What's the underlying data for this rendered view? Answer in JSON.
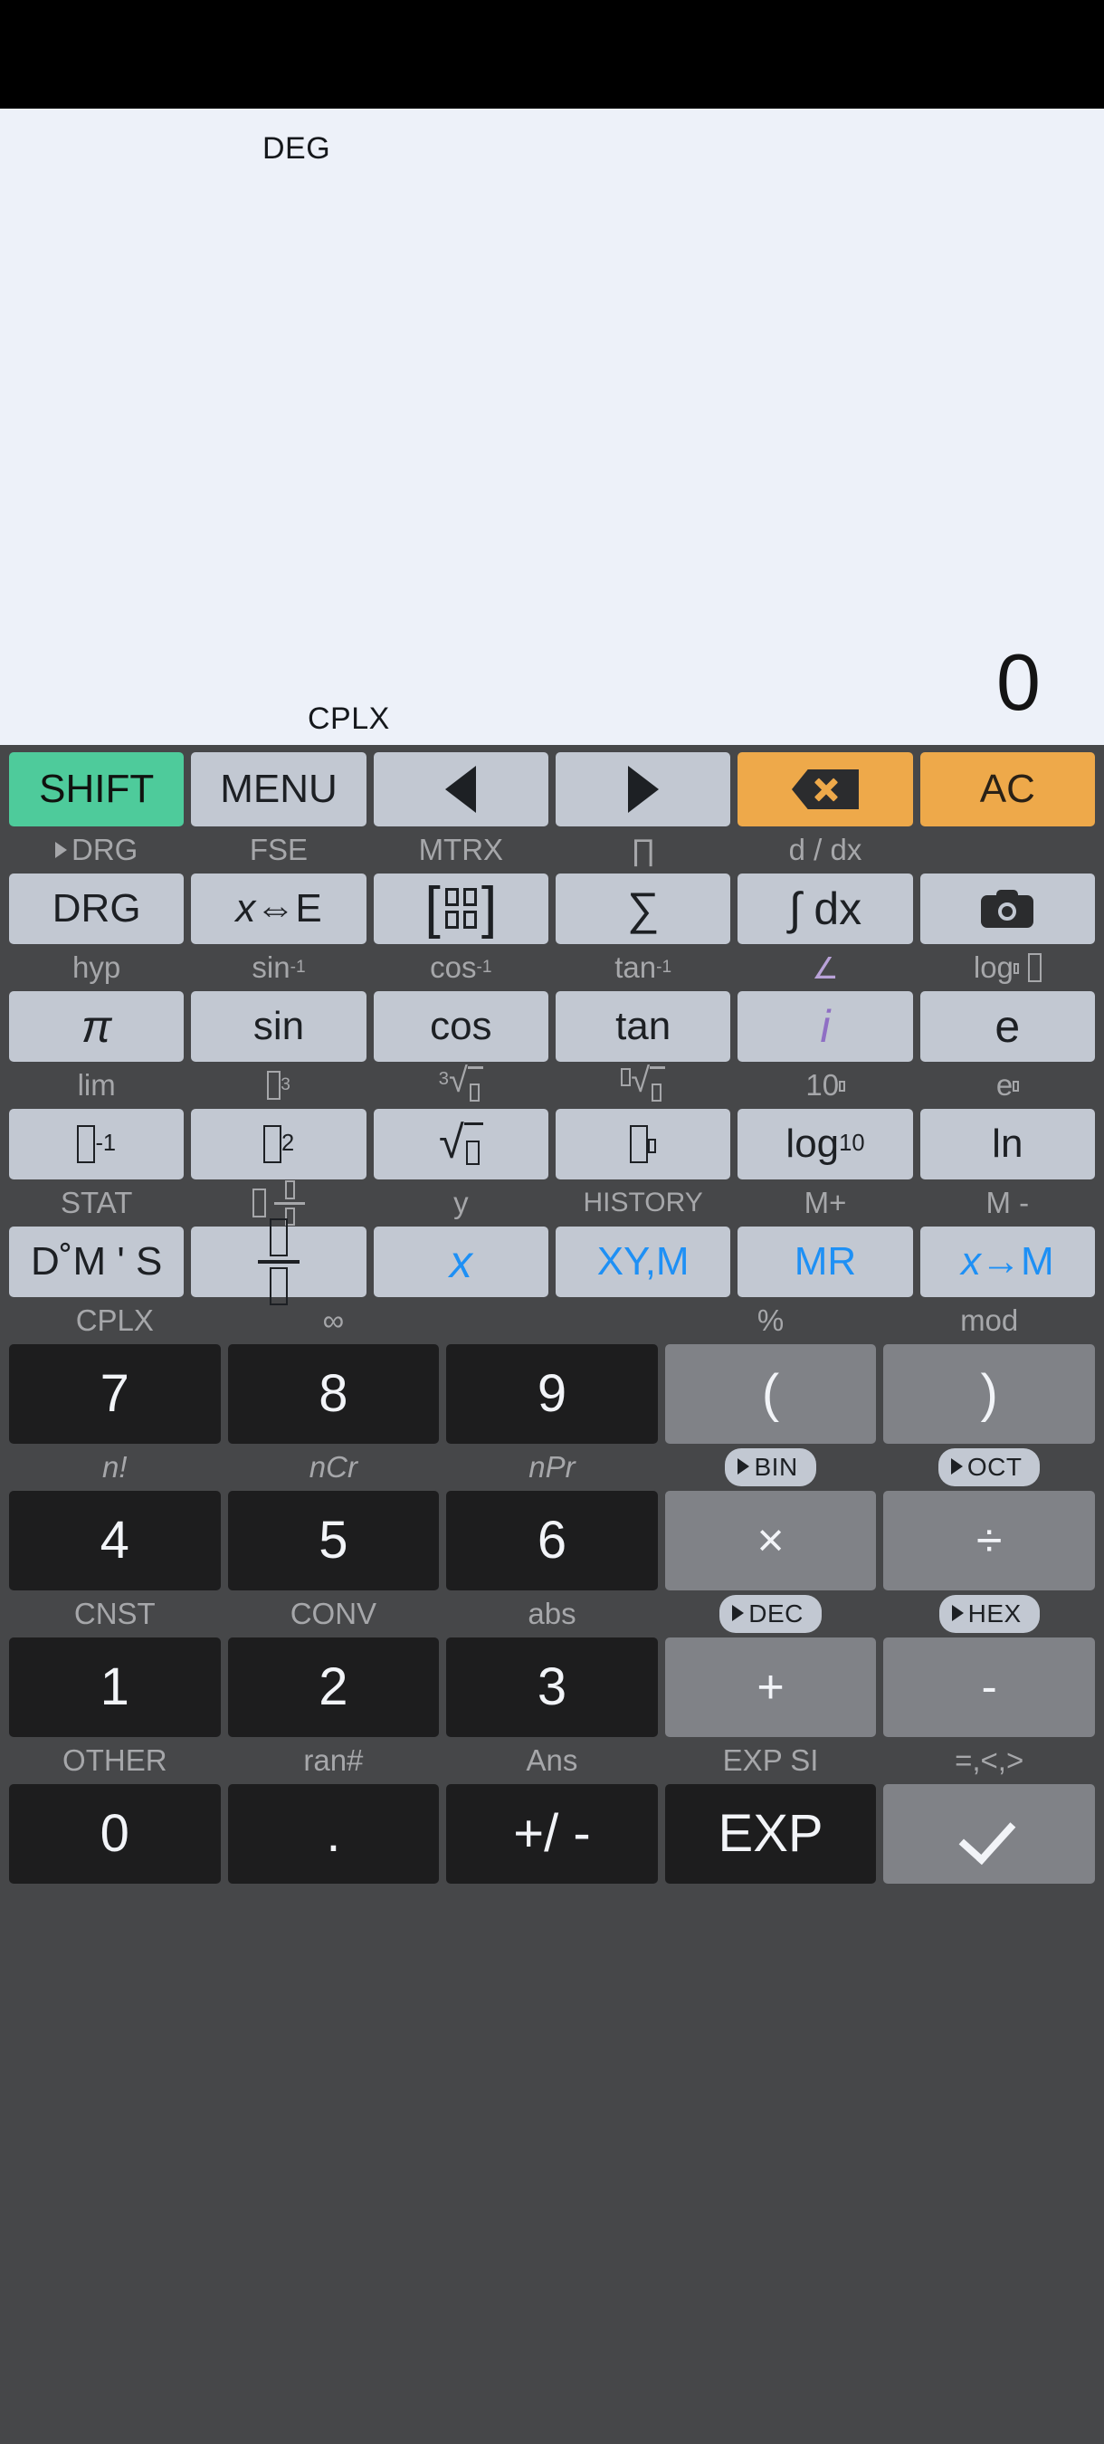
{
  "display": {
    "mode_top": "DEG",
    "value": "0",
    "mode_bottom": "CPLX"
  },
  "colors": {
    "shift": "#4ecb9b",
    "action": "#eea94a",
    "function_key": "#c2c8d2",
    "number_key": "#1d1d1e",
    "operator_key": "#808287",
    "keypad_bg": "#464749",
    "display_bg": "#edf1f9",
    "memory_text": "#1e90f5",
    "complex_text": "#8f6fc4"
  },
  "rows": [
    {
      "name": "top-control-row",
      "labels": [],
      "keys": [
        {
          "name": "shift-button",
          "label": "SHIFT",
          "style": "green"
        },
        {
          "name": "menu-button",
          "label": "MENU",
          "style": "grey"
        },
        {
          "name": "cursor-left-button",
          "label": "",
          "style": "grey",
          "icon": "triangle-left-icon"
        },
        {
          "name": "cursor-right-button",
          "label": "",
          "style": "grey",
          "icon": "triangle-right-icon"
        },
        {
          "name": "backspace-button",
          "label": "",
          "style": "orange",
          "icon": "backspace-icon"
        },
        {
          "name": "all-clear-button",
          "label": "AC",
          "style": "orange"
        }
      ]
    },
    {
      "name": "drg-row",
      "labels": [
        {
          "name": "shift-label-drg-convert",
          "text": "►DRG"
        },
        {
          "name": "shift-label-fse",
          "text": "FSE"
        },
        {
          "name": "shift-label-mtrx",
          "text": "MTRX"
        },
        {
          "name": "shift-label-product",
          "text": "∏"
        },
        {
          "name": "shift-label-derivative",
          "text": "d / dx"
        },
        {
          "name": "shift-label-blank-camera",
          "text": ""
        }
      ],
      "keys": [
        {
          "name": "drg-button",
          "label": "DRG",
          "style": "grey"
        },
        {
          "name": "x-to-e-button",
          "label": "x⇔E",
          "style": "grey"
        },
        {
          "name": "matrix-button",
          "label": "",
          "style": "grey",
          "icon": "matrix-icon"
        },
        {
          "name": "summation-button",
          "label": "∑",
          "style": "grey"
        },
        {
          "name": "integral-dx-button",
          "label": "∫ dx",
          "style": "grey"
        },
        {
          "name": "screenshot-button",
          "label": "",
          "style": "grey",
          "icon": "camera-icon"
        }
      ]
    },
    {
      "name": "trig-row",
      "labels": [
        {
          "name": "shift-label-hyp",
          "text": "hyp"
        },
        {
          "name": "shift-label-asin",
          "text": "sin⁻¹"
        },
        {
          "name": "shift-label-acos",
          "text": "cos⁻¹"
        },
        {
          "name": "shift-label-atan",
          "text": "tan⁻¹"
        },
        {
          "name": "shift-label-angle",
          "text": "∠",
          "color": "purple"
        },
        {
          "name": "shift-label-log-base",
          "text": "log"
        }
      ],
      "keys": [
        {
          "name": "pi-button",
          "label": "π",
          "style": "grey"
        },
        {
          "name": "sin-button",
          "label": "sin",
          "style": "grey"
        },
        {
          "name": "cos-button",
          "label": "cos",
          "style": "grey"
        },
        {
          "name": "tan-button",
          "label": "tan",
          "style": "grey"
        },
        {
          "name": "imaginary-unit-button",
          "label": "i",
          "style": "grey",
          "text_color": "purple"
        },
        {
          "name": "euler-e-button",
          "label": "e",
          "style": "grey"
        }
      ]
    },
    {
      "name": "power-row",
      "labels": [
        {
          "name": "shift-label-lim",
          "text": "lim"
        },
        {
          "name": "shift-label-cube",
          "text": "cube"
        },
        {
          "name": "shift-label-cube-root",
          "text": "cube-root"
        },
        {
          "name": "shift-label-nth-root",
          "text": "nth-root"
        },
        {
          "name": "shift-label-ten-power",
          "text": "10"
        },
        {
          "name": "shift-label-e-power",
          "text": "e"
        }
      ],
      "keys": [
        {
          "name": "reciprocal-button",
          "label": "inverse",
          "style": "grey"
        },
        {
          "name": "square-button",
          "label": "square",
          "style": "grey"
        },
        {
          "name": "square-root-button",
          "label": "sqrt",
          "style": "grey"
        },
        {
          "name": "power-button",
          "label": "power",
          "style": "grey"
        },
        {
          "name": "log10-button",
          "label": "log",
          "style": "grey"
        },
        {
          "name": "ln-button",
          "label": "ln",
          "style": "grey"
        }
      ]
    },
    {
      "name": "memory-row",
      "labels": [
        {
          "name": "shift-label-stat",
          "text": "STAT"
        },
        {
          "name": "shift-label-mixed-fraction",
          "text": "mixed-fraction"
        },
        {
          "name": "shift-label-y",
          "text": "y"
        },
        {
          "name": "shift-label-history",
          "text": "HISTORY"
        },
        {
          "name": "shift-label-m-plus",
          "text": "M+"
        },
        {
          "name": "shift-label-m-minus",
          "text": "M -"
        }
      ],
      "keys": [
        {
          "name": "dms-button",
          "label": "D˚M ' S",
          "style": "grey"
        },
        {
          "name": "fraction-button",
          "label": "fraction",
          "style": "grey"
        },
        {
          "name": "var-x-button",
          "label": "x",
          "style": "grey",
          "text_color": "blue"
        },
        {
          "name": "xy-memory-button",
          "label": "XY,M",
          "style": "grey",
          "text_color": "blue"
        },
        {
          "name": "memory-recall-button",
          "label": "MR",
          "style": "grey",
          "text_color": "blue"
        },
        {
          "name": "store-to-memory-button",
          "label": "x→M",
          "style": "grey",
          "text_color": "blue"
        }
      ]
    },
    {
      "name": "789-row",
      "labels": [
        {
          "name": "shift-label-cplx",
          "text": "CPLX"
        },
        {
          "name": "shift-label-infinity",
          "text": "∞"
        },
        {
          "name": "shift-label-blank-9",
          "text": ""
        },
        {
          "name": "shift-label-percent",
          "text": "%"
        },
        {
          "name": "shift-label-mod",
          "text": "mod"
        }
      ],
      "keys": [
        {
          "name": "digit-7-button",
          "label": "7",
          "style": "dark"
        },
        {
          "name": "digit-8-button",
          "label": "8",
          "style": "dark"
        },
        {
          "name": "digit-9-button",
          "label": "9",
          "style": "dark"
        },
        {
          "name": "open-paren-button",
          "label": "(",
          "style": "mid"
        },
        {
          "name": "close-paren-button",
          "label": ")",
          "style": "mid"
        }
      ]
    },
    {
      "name": "456-row",
      "labels": [
        {
          "name": "shift-label-factorial",
          "text": "n!"
        },
        {
          "name": "shift-label-ncr",
          "text": "nCr"
        },
        {
          "name": "shift-label-npr",
          "text": "nPr"
        },
        {
          "name": "shift-label-to-bin",
          "text": "►BIN",
          "pill": true
        },
        {
          "name": "shift-label-to-oct",
          "text": "►OCT",
          "pill": true
        }
      ],
      "keys": [
        {
          "name": "digit-4-button",
          "label": "4",
          "style": "dark"
        },
        {
          "name": "digit-5-button",
          "label": "5",
          "style": "dark"
        },
        {
          "name": "digit-6-button",
          "label": "6",
          "style": "dark"
        },
        {
          "name": "multiply-button",
          "label": "×",
          "style": "mid"
        },
        {
          "name": "divide-button",
          "label": "÷",
          "style": "mid"
        }
      ]
    },
    {
      "name": "123-row",
      "labels": [
        {
          "name": "shift-label-cnst",
          "text": "CNST"
        },
        {
          "name": "shift-label-conv",
          "text": "CONV"
        },
        {
          "name": "shift-label-abs",
          "text": "abs"
        },
        {
          "name": "shift-label-to-dec",
          "text": "►DEC",
          "pill": true
        },
        {
          "name": "shift-label-to-hex",
          "text": "►HEX",
          "pill": true
        }
      ],
      "keys": [
        {
          "name": "digit-1-button",
          "label": "1",
          "style": "dark"
        },
        {
          "name": "digit-2-button",
          "label": "2",
          "style": "dark"
        },
        {
          "name": "digit-3-button",
          "label": "3",
          "style": "dark"
        },
        {
          "name": "plus-button",
          "label": "+",
          "style": "mid"
        },
        {
          "name": "minus-button",
          "label": "-",
          "style": "mid"
        }
      ]
    },
    {
      "name": "0-row",
      "labels": [
        {
          "name": "shift-label-other",
          "text": "OTHER"
        },
        {
          "name": "shift-label-random",
          "text": "ran#"
        },
        {
          "name": "shift-label-ans",
          "text": "Ans"
        },
        {
          "name": "shift-label-exp-si",
          "text": "EXP SI"
        },
        {
          "name": "shift-label-relations",
          "text": "=,<,>"
        }
      ],
      "keys": [
        {
          "name": "digit-0-button",
          "label": "0",
          "style": "dark"
        },
        {
          "name": "decimal-point-button",
          "label": ".",
          "style": "dark"
        },
        {
          "name": "sign-toggle-button",
          "label": "+/ -",
          "style": "dark"
        },
        {
          "name": "exponent-button",
          "label": "EXP",
          "style": "dark"
        },
        {
          "name": "equals-button",
          "label": "",
          "style": "mid",
          "icon": "check-icon"
        }
      ]
    }
  ]
}
